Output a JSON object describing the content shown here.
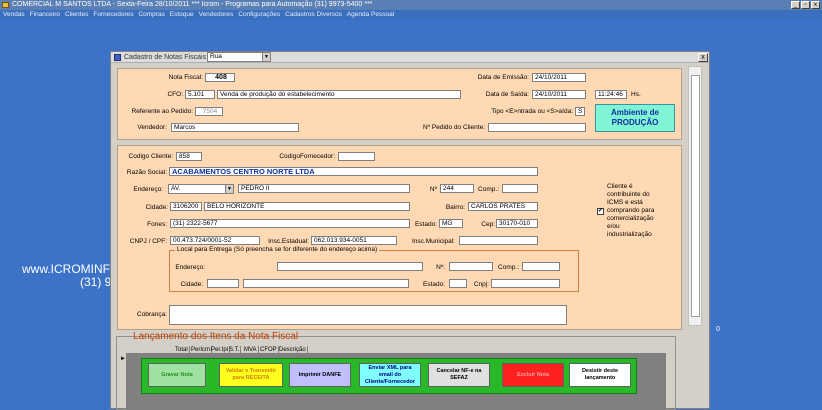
{
  "app": {
    "title": "COMERCIAL M SANTOS LTDA - Sexta-Feira  28/10/2011          ***  Icrom  -  Programas para Automação (31) 9973-5400  ***",
    "menu": [
      "Vendas",
      "Financeiro",
      "Clientes",
      "Fornecedores",
      "Compras",
      "Estoque",
      "Vendedores",
      "Configurações",
      "Cadastros Diversos",
      "Agenda Pessoal"
    ],
    "desktop_text1": "www.ICROMINF",
    "desktop_text2": "(31) 9",
    "side_value": "0",
    "win_min": "_",
    "win_max": "▫",
    "win_close": "x"
  },
  "dialog": {
    "title": "Cadastro de Notas Fiscais Eletronica",
    "close": "x"
  },
  "header": {
    "nota_fiscal_label": "Nota Fiscal:",
    "nota_fiscal": "408",
    "cfo_label": "CFO:",
    "cfo_code": "5.101",
    "cfo_desc": "Venda de produção do estabelecimento",
    "referente_label": "Referente ao Pedido:",
    "referente": "7504",
    "vendedor_label": "Vendedor:",
    "vendedor": "Marcos",
    "emissao_label": "Data de Emissão:",
    "emissao": "24/10/2011",
    "saida_label": "Data de Saída:",
    "saida": "24/10/2011",
    "hora": "11:24:46",
    "hora_unit": "Hs.",
    "tipo_label": "Tipo <E>ntrada ou <S>aída:",
    "tipo": "S",
    "pedido_cliente_label": "Nº Pedido do Cliente:",
    "pedido_cliente": "",
    "ambiente_line1": "Ambiente de",
    "ambiente_line2": "PRODUÇÃO"
  },
  "cliente": {
    "codigo_label": "Codigo Cliente:",
    "codigo": "858",
    "codforn_label": "CodigoFornecedor:",
    "codforn": "",
    "razao_label": "Razão Social:",
    "razao": "ACABAMENTOS CENTRO NORTE LTDA",
    "endereco_label": "Endereço:",
    "endereco_tipo": "AV.",
    "endereco": "PEDRO II",
    "numero_label": "Nº",
    "numero": "244",
    "comp_label": "Comp.:",
    "comp": "",
    "cidade_label": "Cidade:",
    "cidade_cod": "3106200",
    "cidade": "BELO HORIZONTE",
    "bairro_label": "Bairro:",
    "bairro": "CARLOS PRATES",
    "fones_label": "Fones:",
    "fones": "(31) 2322-5677",
    "estado_label": "Estado:",
    "estado": "MG",
    "cep_label": "Cep:",
    "cep": "30170-010",
    "cnpj_label": "CNPJ / CPF:",
    "cnpj": "00.473.724/0001-52",
    "insc_est_label": "Insc.Estadual:",
    "insc_est": "062.013.934-0051",
    "insc_mun_label": "Insc.Municipal:",
    "insc_mun": "",
    "icms_text": [
      "Cliente é",
      "contribuinte do",
      "ICMS e está",
      "comprando para",
      "comercialização",
      "e/ou",
      "industrialização"
    ],
    "icms_check": "✔"
  },
  "entrega": {
    "legend": "Local para Entrega  (Só preencha se for diferente do endereço acima)",
    "endereco_label": "Endereço:",
    "endereco_tipo": "Rua",
    "numero_label": "Nº:",
    "comp_label": "Comp.:",
    "cidade_label": "Cidade:",
    "estado_label": "Estado:",
    "cnpj_label": "Cnpj:"
  },
  "cobranca_label": "Cobrança:",
  "items": {
    "title": "Lançamento dos Itens da Nota Fiscal",
    "columns": [
      "Total",
      "PerIcm",
      "Per.Ipi",
      "S.T.",
      "MVA",
      "CFOP",
      "Descrição"
    ],
    "row_marker": "►"
  },
  "actions": [
    {
      "label": "Gravar Nota",
      "bg": "#a0e0a0",
      "fg": "#209020"
    },
    {
      "label": "Validar e Transmitir para RECEITA",
      "bg": "#ffff20",
      "fg": "#d08000"
    },
    {
      "label": "Imprimir DANFE",
      "bg": "#c0c0ff",
      "fg": "#000000"
    },
    {
      "label": "Enviar XML para email do Cliente/Fornecedor",
      "bg": "#80ffff",
      "fg": "#000080"
    },
    {
      "label": "Cancelar NF-e na SEFAZ",
      "bg": "#e0e0e0",
      "fg": "#000000"
    },
    {
      "label": "Excluir Nota",
      "bg": "#ff2020",
      "fg": "#ffa0a0"
    },
    {
      "label": "Desistir deste lançamento",
      "bg": "#ffffff",
      "fg": "#000000"
    }
  ]
}
